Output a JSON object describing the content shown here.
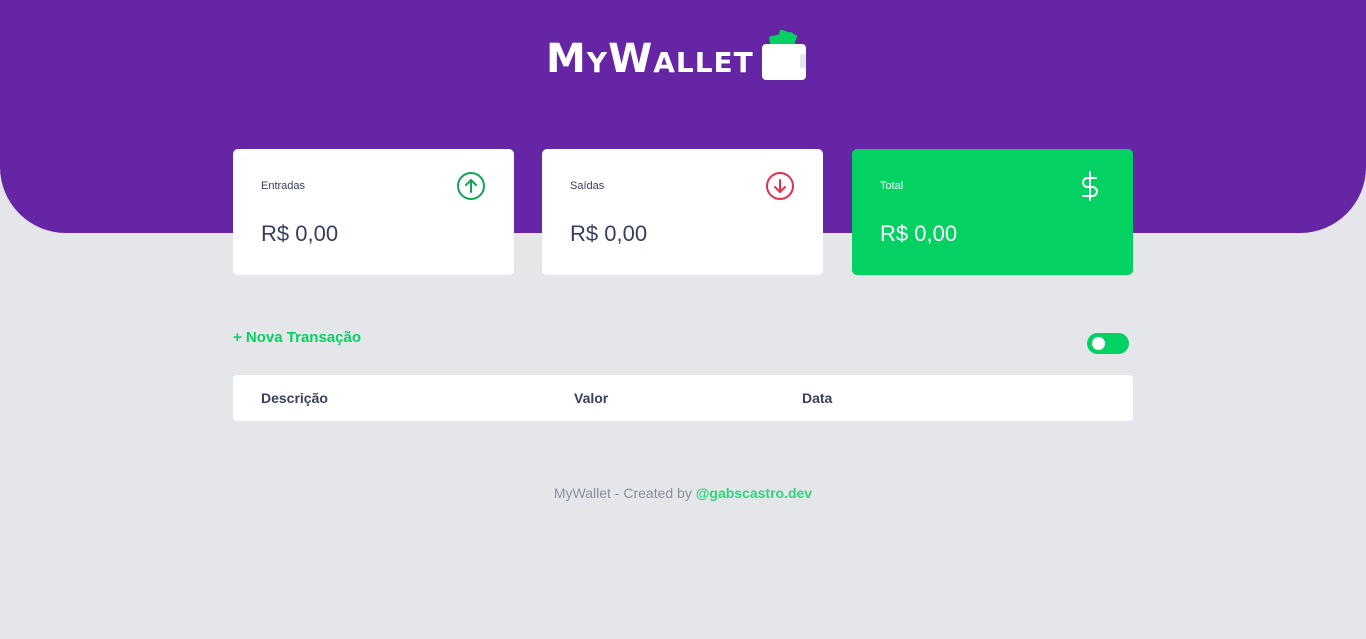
{
  "brand": {
    "name": "MyWallet",
    "icon": "wallet-icon"
  },
  "summary": {
    "income": {
      "label": "Entradas",
      "amount": "R$ 0,00",
      "icon": "arrow-up-circle-icon",
      "color": "#12a454"
    },
    "expense": {
      "label": "Saídas",
      "amount": "R$ 0,00",
      "icon": "arrow-down-circle-icon",
      "color": "#e52e4d"
    },
    "total": {
      "label": "Total",
      "amount": "R$ 0,00",
      "icon": "dollar-sign-icon",
      "color": "#03d263"
    }
  },
  "actions": {
    "new_transaction": "+ Nova Transação"
  },
  "theme_toggle": {
    "state": "on"
  },
  "table": {
    "headers": [
      "Descrição",
      "Valor",
      "Data"
    ]
  },
  "footer": {
    "text": "MyWallet - Created by ",
    "link": "@gabscastro.dev"
  },
  "colors": {
    "header": "#6625a4",
    "accent": "#03d263",
    "background": "#e5e6ea"
  }
}
